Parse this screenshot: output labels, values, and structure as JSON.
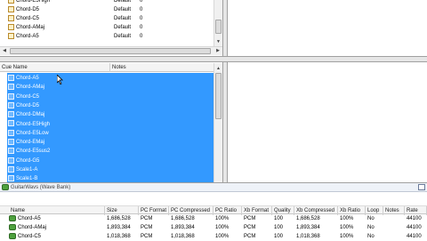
{
  "top_list": {
    "rows": [
      {
        "name": "Chord-E5High",
        "category": "Default",
        "value": "0"
      },
      {
        "name": "Chord-D5",
        "category": "Default",
        "value": "0"
      },
      {
        "name": "Chord-C5",
        "category": "Default",
        "value": "0"
      },
      {
        "name": "Chord-AMaj",
        "category": "Default",
        "value": "0"
      },
      {
        "name": "Chord-A5",
        "category": "Default",
        "value": "0"
      }
    ]
  },
  "cue_list": {
    "columns": [
      "Cue Name",
      "Notes"
    ],
    "rows": [
      "Chord-A5",
      "Chord-AMaj",
      "Chord-C5",
      "Chord-D5",
      "Chord-DMaj",
      "Chord-E5High",
      "Chord-E5Low",
      "Chord-EMaj",
      "Chord-E5sus2",
      "Chord-G5",
      "Scale1-A",
      "Scale1-B"
    ]
  },
  "wave_bank": {
    "title": "GuitarWavs (Wave Bank)",
    "columns": [
      "Name",
      "Size",
      "PC Format",
      "PC Compressed",
      "PC Ratio",
      "Xb Format",
      "Quality",
      "Xb Compressed",
      "Xb Ratio",
      "Loop",
      "Notes",
      "Rate"
    ],
    "rows": [
      [
        "Chord-A5",
        "1,686,528",
        "PCM",
        "1,686,528",
        "100%",
        "PCM",
        "100",
        "1,686,528",
        "100%",
        "No",
        "",
        "44100"
      ],
      [
        "Chord-AMaj",
        "1,893,384",
        "PCM",
        "1,893,384",
        "100%",
        "PCM",
        "100",
        "1,893,384",
        "100%",
        "No",
        "",
        "44100"
      ],
      [
        "Chord-C5",
        "1,018,368",
        "PCM",
        "1,018,368",
        "100%",
        "PCM",
        "100",
        "1,018,368",
        "100%",
        "No",
        "",
        "44100"
      ]
    ]
  },
  "colors": {
    "selection": "#3399ff",
    "header_bg": "#f4f4f4",
    "panel_border": "#a0a0a0"
  }
}
